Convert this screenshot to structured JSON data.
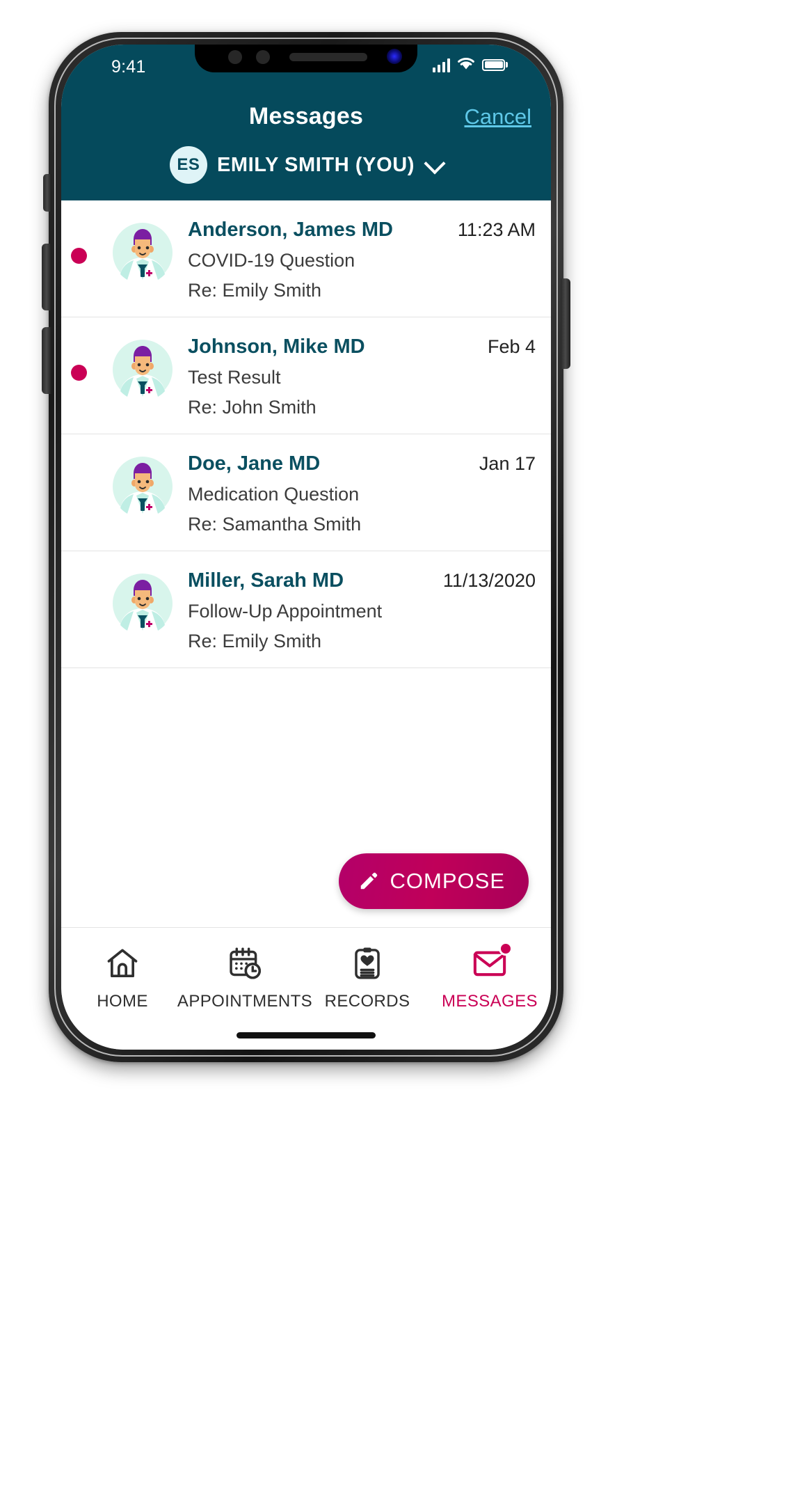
{
  "status_bar": {
    "time": "9:41",
    "signal_icon": "cellular-signal-icon",
    "wifi_icon": "wifi-icon",
    "battery_icon": "battery-full-icon"
  },
  "header": {
    "title": "Messages",
    "cancel_label": "Cancel",
    "account": {
      "initials": "ES",
      "name": "EMILY SMITH (YOU)",
      "chevron_icon": "chevron-down-icon"
    },
    "background_color": "#054a5c",
    "link_color": "#5fc8e8"
  },
  "messages": [
    {
      "from": "Anderson, James MD",
      "subject": "COVID-19 Question",
      "regarding": "Re: Emily Smith",
      "time": "11:23 AM",
      "unread": true
    },
    {
      "from": "Johnson, Mike MD",
      "subject": "Test Result",
      "regarding": "Re: John Smith",
      "time": "Feb 4",
      "unread": true
    },
    {
      "from": "Doe, Jane MD",
      "subject": "Medication Question",
      "regarding": "Re: Samantha Smith",
      "time": "Jan 17",
      "unread": false
    },
    {
      "from": "Miller, Sarah MD",
      "subject": "Follow-Up Appointment",
      "regarding": "Re: Emily Smith",
      "time": "11/13/2020",
      "unread": false
    }
  ],
  "compose_button": {
    "label": "COMPOSE",
    "icon": "pencil-icon",
    "color": "#b8005e"
  },
  "tab_bar": {
    "items": [
      {
        "label": "HOME",
        "icon": "home-icon",
        "active": false,
        "badge": false
      },
      {
        "label": "APPOINTMENTS",
        "icon": "calendar-clock-icon",
        "active": false,
        "badge": false
      },
      {
        "label": "RECORDS",
        "icon": "clipboard-heart-icon",
        "active": false,
        "badge": false
      },
      {
        "label": "MESSAGES",
        "icon": "envelope-icon",
        "active": true,
        "badge": true
      }
    ],
    "active_color": "#ca0055",
    "inactive_color": "#2f2f2f"
  },
  "colors": {
    "unread_dot": "#ca0055",
    "sender_name": "#0a4f60",
    "avatar_bg": "#d8f5ec"
  }
}
